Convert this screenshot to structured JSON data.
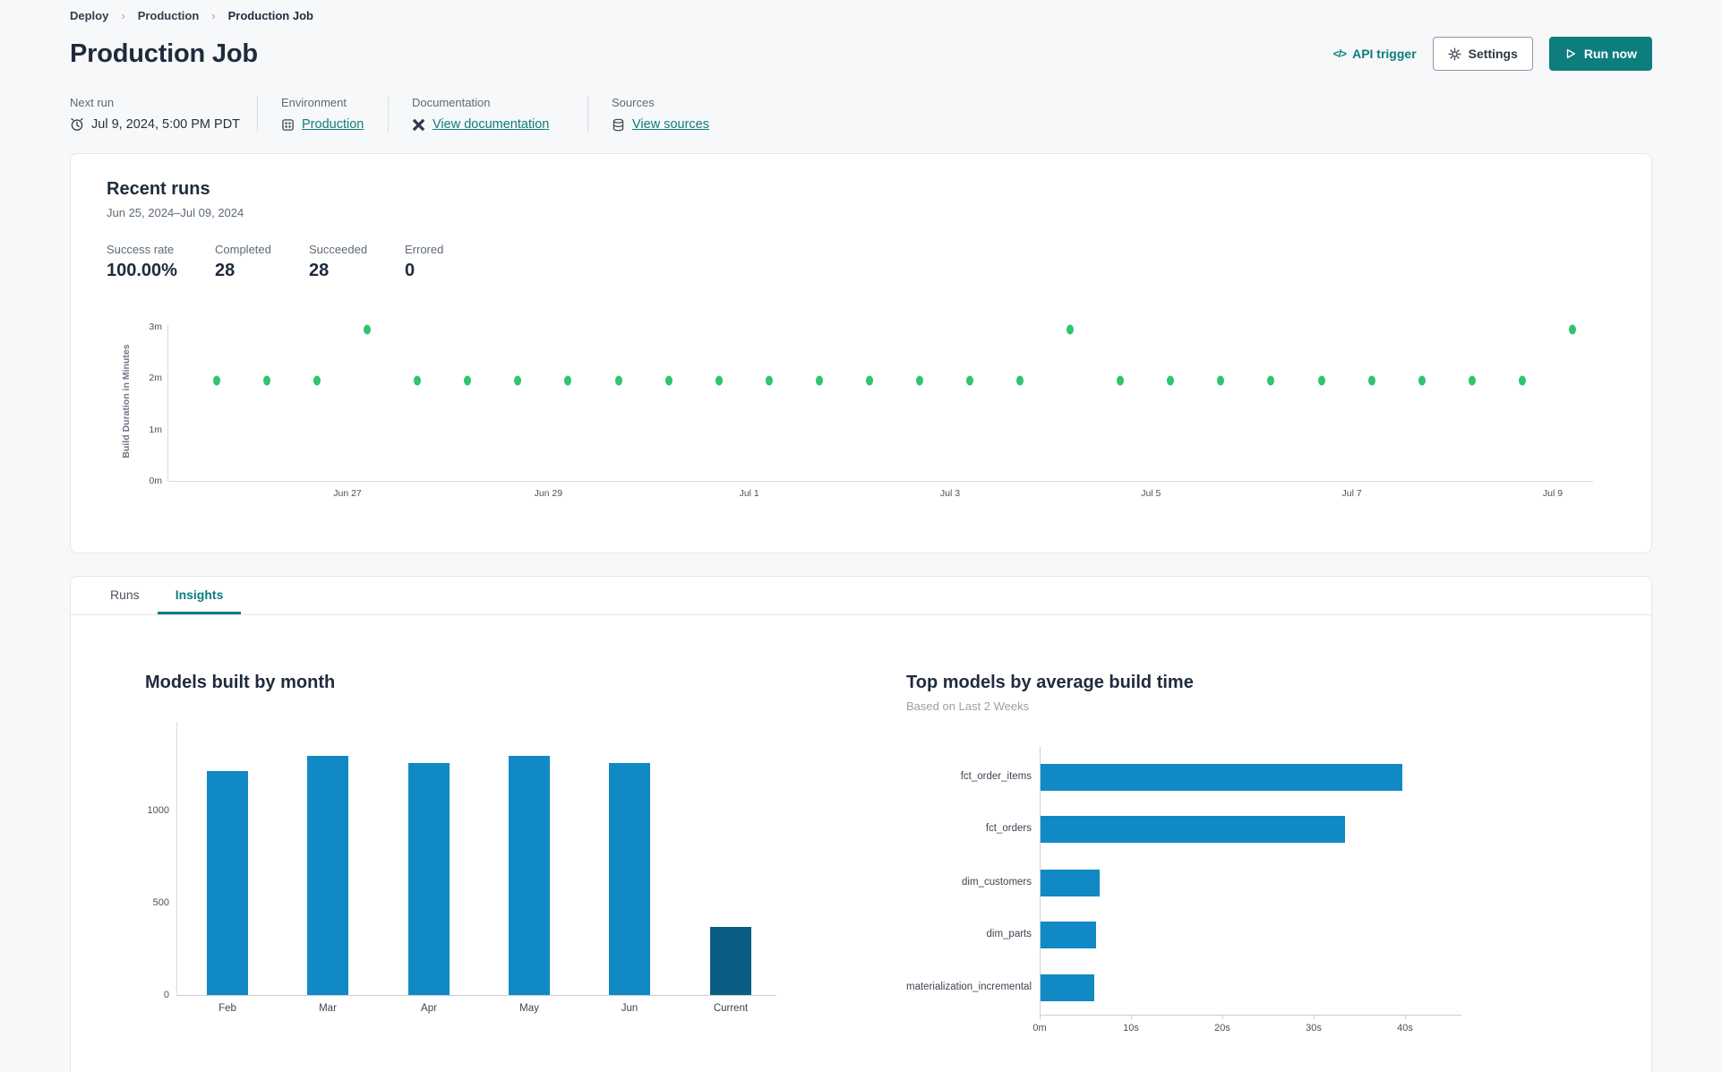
{
  "breadcrumb": {
    "items": [
      "Deploy",
      "Production",
      "Production Job"
    ],
    "separator": "›"
  },
  "header": {
    "title": "Production Job",
    "api_trigger": "API trigger",
    "settings": "Settings",
    "run_now": "Run now"
  },
  "meta": {
    "next_run": {
      "label": "Next run",
      "value": "Jul 9, 2024, 5:00 PM PDT"
    },
    "environment": {
      "label": "Environment",
      "value": "Production"
    },
    "documentation": {
      "label": "Documentation",
      "value": "View documentation"
    },
    "sources": {
      "label": "Sources",
      "value": "View sources"
    }
  },
  "recent_runs": {
    "title": "Recent runs",
    "date_range": "Jun 25, 2024–Jul 09, 2024",
    "stats": [
      {
        "label": "Success rate",
        "value": "100.00%"
      },
      {
        "label": "Completed",
        "value": "28"
      },
      {
        "label": "Succeeded",
        "value": "28"
      },
      {
        "label": "Errored",
        "value": "0"
      }
    ]
  },
  "tabs": [
    {
      "label": "Runs",
      "active": false
    },
    {
      "label": "Insights",
      "active": true
    }
  ],
  "chart_data": [
    {
      "id": "build_duration",
      "type": "scatter",
      "ylabel": "Build Duration in Minutes",
      "y_tick_labels": [
        "0m",
        "1m",
        "2m",
        "3m"
      ],
      "y_tick_values": [
        0,
        1,
        2,
        3
      ],
      "ylim": [
        0,
        3.5
      ],
      "x_tick_labels": [
        "Jun 27",
        "Jun 29",
        "Jul 1",
        "Jul 3",
        "Jul 5",
        "Jul 7",
        "Jul 9"
      ],
      "points_minutes": [
        1.95,
        1.95,
        1.95,
        2.95,
        1.95,
        1.95,
        1.95,
        1.95,
        1.95,
        1.95,
        1.95,
        1.95,
        1.95,
        1.95,
        1.95,
        1.95,
        1.95,
        2.95,
        1.95,
        1.95,
        1.95,
        1.95,
        1.95,
        1.95,
        1.95,
        1.95,
        1.95,
        2.95
      ],
      "point_color": "#30c56f",
      "grid": false
    },
    {
      "id": "models_by_month",
      "type": "bar",
      "title": "Models built by month",
      "categories": [
        "Feb",
        "Mar",
        "Apr",
        "May",
        "Jun",
        "Current"
      ],
      "values": [
        1215,
        1295,
        1255,
        1295,
        1255,
        370
      ],
      "y_ticks": [
        0,
        500,
        1000
      ],
      "ylim": [
        0,
        1470
      ],
      "bar_color": "#1189c5",
      "highlight_index": 5,
      "highlight_color": "#0a5d83",
      "grid": false
    },
    {
      "id": "top_models",
      "type": "bar",
      "orientation": "horizontal",
      "title": "Top models by average build time",
      "subtitle": "Based on Last 2 Weeks",
      "categories": [
        "fct_order_items",
        "fct_orders",
        "dim_customers",
        "dim_parts",
        "materialization_incremental"
      ],
      "values_seconds": [
        39.6,
        33.3,
        6.5,
        6.1,
        5.9
      ],
      "x_tick_labels": [
        "0m",
        "10s",
        "20s",
        "30s",
        "40s"
      ],
      "x_tick_values": [
        0,
        10,
        20,
        30,
        40
      ],
      "xlim": [
        0,
        50
      ],
      "bar_color": "#1189c5",
      "grid": false
    }
  ],
  "colors": {
    "accent_teal": "#0e7d7d",
    "chart_blue": "#1189c5",
    "chart_blue_dark": "#0a5d83",
    "dot_green": "#30c56f",
    "text_dark": "#1f2b3d",
    "text_gray": "#5d6a77",
    "page_bg": "#f7f8f9"
  }
}
